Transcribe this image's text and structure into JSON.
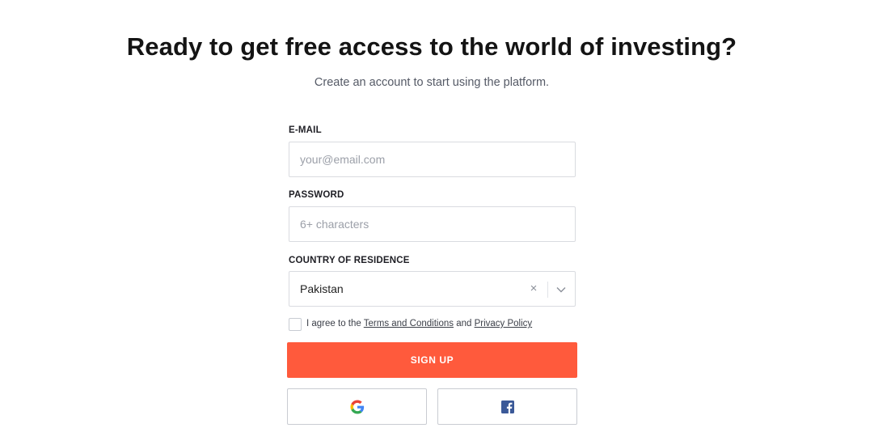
{
  "header": {
    "title": "Ready to get free access to the world of investing?",
    "subtitle": "Create an account to start using the platform."
  },
  "form": {
    "email": {
      "label": "E-MAIL",
      "placeholder": "your@email.com",
      "value": ""
    },
    "password": {
      "label": "PASSWORD",
      "placeholder": "6+ characters",
      "value": ""
    },
    "country": {
      "label": "COUNTRY OF RESIDENCE",
      "selected": "Pakistan",
      "clear_glyph": "×"
    },
    "agreement": {
      "checked": false,
      "prefix": "I agree to the ",
      "terms_link": "Terms and Conditions",
      "middle": " and ",
      "privacy_link": "Privacy Policy"
    },
    "signup_label": "SIGN UP",
    "social": [
      {
        "name": "google",
        "icon": "google-icon"
      },
      {
        "name": "facebook",
        "icon": "facebook-icon"
      }
    ]
  },
  "colors": {
    "accent": "#ff5a3c",
    "facebook": "#3b5998",
    "google_blue": "#4285F4",
    "google_red": "#EA4335",
    "google_yellow": "#FBBC05",
    "google_green": "#34A853"
  }
}
